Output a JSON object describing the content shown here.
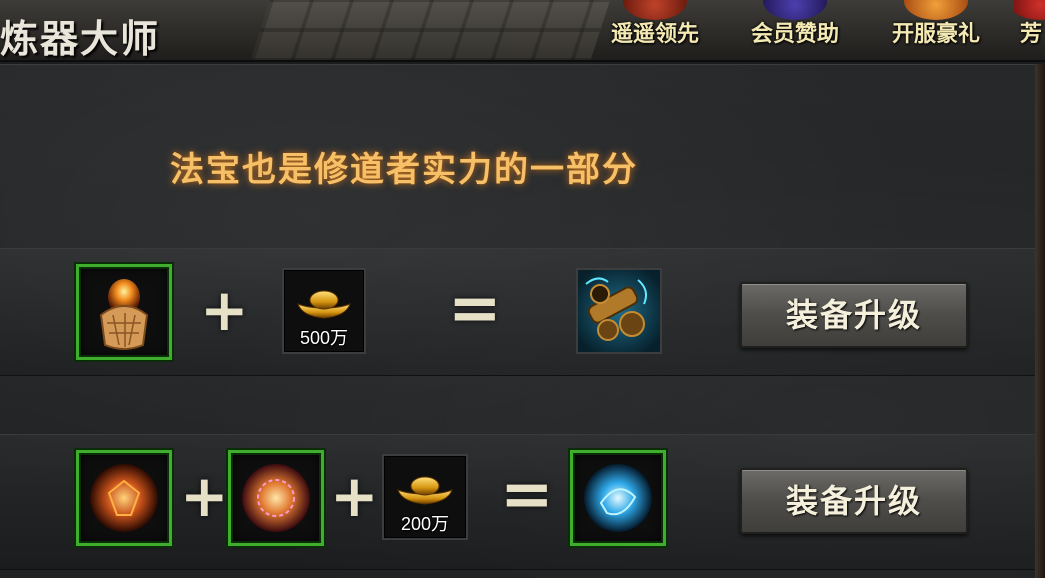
{
  "header": {
    "title": "炼器大师",
    "menu": [
      {
        "label": "遥遥领先",
        "badge_icon": "lantern-icon"
      },
      {
        "label": "会员赞助",
        "badge_icon": "vip-icon"
      },
      {
        "label": "开服豪礼",
        "badge_icon": "gift-icon"
      },
      {
        "label": "芳",
        "badge_icon": "gift-icon"
      }
    ]
  },
  "subtitle": "法宝也是修道者实力的一部分",
  "recipes": [
    {
      "inputs": [
        {
          "icon": "flame-pouch-icon",
          "quantity": ""
        },
        {
          "icon": "gold-ingot-icon",
          "quantity": "500万"
        }
      ],
      "result": {
        "icon": "cannon-icon"
      },
      "button_label": "装备升级"
    },
    {
      "inputs": [
        {
          "icon": "fire-orb-icon",
          "quantity": ""
        },
        {
          "icon": "flame-orb-icon",
          "quantity": ""
        },
        {
          "icon": "gold-ingot-icon",
          "quantity": "200万"
        }
      ],
      "result": {
        "icon": "ice-orb-icon"
      },
      "button_label": "装备升级"
    }
  ],
  "colors": {
    "slot_border": "#3fae2d",
    "subtitle": "#f6c068",
    "menu_label": "#f4e9b3",
    "button_text": "#f5f0dc"
  }
}
